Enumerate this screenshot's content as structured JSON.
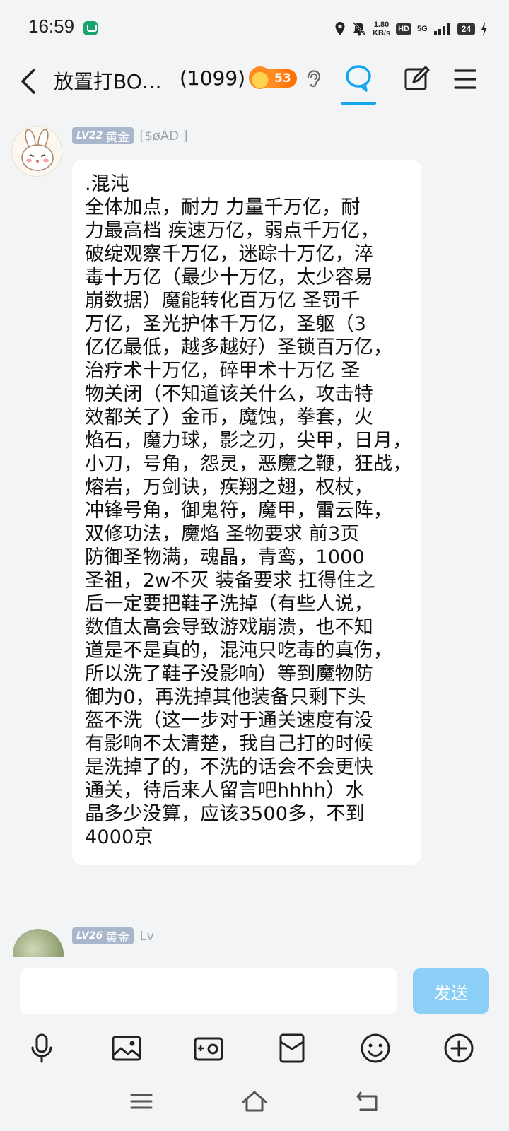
{
  "status_bar": {
    "time": "16:59",
    "net_speed_value": "1.80",
    "net_speed_unit": "KB/s",
    "hd_label": "HD",
    "network_label": "5G",
    "battery": "24"
  },
  "header": {
    "title": "放置打BO…",
    "member_count": "(1099)",
    "fire_level": "53"
  },
  "message": {
    "sender_level": "LV22",
    "sender_rank": "黄金",
    "sender_name": "[$øĀD ]",
    "lines": [
      ".混沌",
      "全体加点，耐力 力量千万亿，耐",
      "力最高档 疾速万亿，弱点千万亿，",
      "破绽观察千万亿，迷踪十万亿，淬",
      "毒十万亿（最少十万亿，太少容易",
      "崩数据）魔能转化百万亿 圣罚千",
      "万亿，圣光护体千万亿，圣躯（3",
      "亿亿最低，越多越好）圣锁百万亿，",
      "治疗术十万亿，碎甲术十万亿 圣",
      "物关闭（不知道该关什么，攻击特",
      "效都关了）金币，魔蚀，拳套，火",
      "焰石，魔力球，影之刃，尖甲，日月，",
      "小刀，号角，怨灵，恶魔之鞭，狂战，",
      "熔岩，万剑诀，疾翔之翅，权杖，",
      "冲锋号角，御鬼符，魔甲，雷云阵，",
      "双修功法，魔焰 圣物要求 前3页",
      "防御圣物满，魂晶，青鸾，1000",
      "圣祖，2w不灭 装备要求 扛得住之",
      "后一定要把鞋子洗掉（有些人说，",
      "数值太高会导致游戏崩溃，也不知",
      "道是不是真的，混沌只吃毒的真伤，",
      "所以洗了鞋子没影响）等到魔物防",
      "御为0，再洗掉其他装备只剩下头",
      "盔不洗（这一步对于通关速度有没",
      "有影响不太清楚，我自己打的时候",
      "是洗掉了的，不洗的话会不会更快",
      "通关，待后来人留言吧hhhh）水",
      "晶多少没算，应该3500多，不到",
      "4000京"
    ]
  },
  "next_message": {
    "sender_level": "LV26",
    "sender_rank": "黄金",
    "sender_name": "Lv"
  },
  "input": {
    "value": "",
    "send_label": "发送"
  },
  "colors": {
    "accent": "#12a6f1",
    "send_button": "#8ccff6",
    "badge": "#a9b6cb",
    "background": "#f3f4f6"
  }
}
